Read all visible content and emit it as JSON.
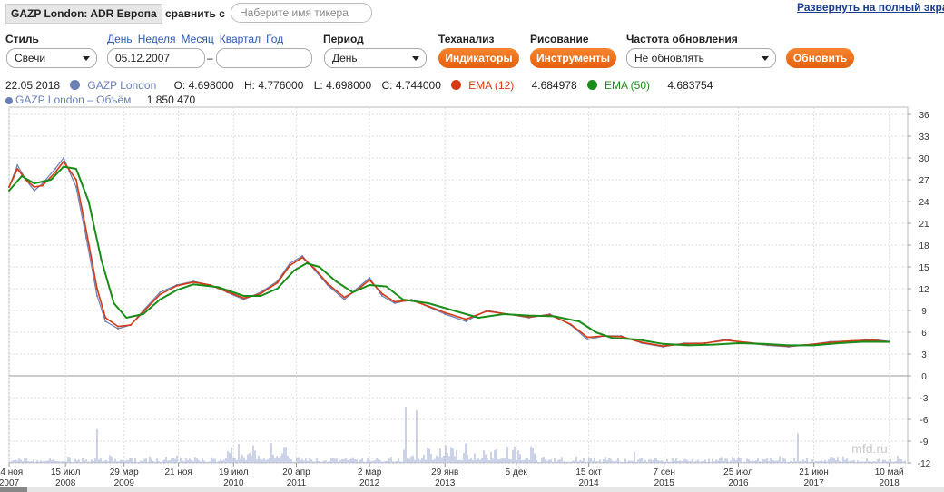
{
  "header": {
    "ticker": "GAZP London: ADR Европа",
    "compare_label": "сравнить с",
    "compare_placeholder": "Наберите имя тикера",
    "fullscreen_link": "Развернуть на полный экра"
  },
  "controls": {
    "style_label": "Стиль",
    "style_value": "Свечи",
    "period_links": [
      "День",
      "Неделя",
      "Месяц",
      "Квартал",
      "Год"
    ],
    "date_from": "05.12.2007",
    "date_dash": "–",
    "date_to": "",
    "period_label": "Период",
    "period_value": "День",
    "ta_label": "Теханализ",
    "ta_button": "Индикаторы",
    "draw_label": "Рисование",
    "draw_button": "Инструменты",
    "refresh_label": "Частота обновления",
    "refresh_value": "Не обновлять",
    "update_button": "Обновить"
  },
  "legend": {
    "date": "22.05.2018",
    "series_name": "GAZP London",
    "open": "O: 4.698000",
    "high": "H: 4.776000",
    "low": "L: 4.698000",
    "close": "C: 4.744000",
    "ema12_name": "EMA (12)",
    "ema12_value": "4.684978",
    "ema50_name": "EMA (50)",
    "ema50_value": "4.683754",
    "volume_name": "GAZP London – Объём",
    "volume_value": "1 850 470"
  },
  "colors": {
    "price": "#6b7fb7",
    "ema12": "#d43a13",
    "ema50": "#1a8c1a",
    "volume": "#9aa6cf",
    "accent": "#e8661a"
  },
  "watermark": "mfd.ru",
  "chart_data": {
    "type": "line",
    "ylim": [
      -12,
      37
    ],
    "yticks": [
      36,
      33,
      30,
      27,
      24,
      21,
      18,
      15,
      12,
      9,
      6,
      3,
      0,
      -3,
      -6,
      -9,
      -12
    ],
    "x_ticks": [
      {
        "t": 0,
        "d": "14 ноя",
        "y": "2007"
      },
      {
        "t": 0.673,
        "d": "15 июл",
        "y": "2008"
      },
      {
        "t": 1.372,
        "d": "29 мар",
        "y": "2009"
      },
      {
        "t": 2.021,
        "d": "21 ноя",
        "y": ""
      },
      {
        "t": 2.678,
        "d": "19 июл",
        "y": "2010"
      },
      {
        "t": 3.427,
        "d": "20 апр",
        "y": "2011"
      },
      {
        "t": 4.3,
        "d": "2 мар",
        "y": "2012"
      },
      {
        "t": 5.2,
        "d": "29 янв",
        "y": "2013"
      },
      {
        "t": 6.05,
        "d": "5 дек",
        "y": ""
      },
      {
        "t": 6.915,
        "d": "15 окт",
        "y": "2014"
      },
      {
        "t": 7.815,
        "d": "7 сен",
        "y": "2015"
      },
      {
        "t": 8.7,
        "d": "25 июл",
        "y": "2016"
      },
      {
        "t": 9.6,
        "d": "21 июн",
        "y": "2017"
      },
      {
        "t": 10.5,
        "d": "10 май",
        "y": "2018"
      }
    ],
    "series": [
      {
        "name": "GAZP London",
        "x": [
          0,
          0.1,
          0.2,
          0.3,
          0.4,
          0.55,
          0.65,
          0.8,
          0.92,
          1.05,
          1.15,
          1.3,
          1.45,
          1.6,
          1.8,
          2.0,
          2.2,
          2.4,
          2.6,
          2.8,
          3.0,
          3.2,
          3.35,
          3.5,
          3.65,
          3.8,
          4.0,
          4.15,
          4.3,
          4.45,
          4.6,
          4.8,
          5.0,
          5.2,
          5.45,
          5.7,
          5.95,
          6.2,
          6.45,
          6.7,
          6.9,
          7.1,
          7.3,
          7.55,
          7.8,
          8.05,
          8.3,
          8.55,
          8.8,
          9.05,
          9.3,
          9.55,
          9.8,
          10.05,
          10.3,
          10.5
        ],
        "values": [
          26,
          29,
          27,
          25.5,
          26.5,
          28.5,
          30,
          26,
          19,
          11,
          7.5,
          6.5,
          7,
          9,
          11.5,
          12.5,
          13,
          12.5,
          11.5,
          10.5,
          11.5,
          13,
          15.5,
          16.5,
          14.5,
          12.5,
          10.5,
          12,
          13.5,
          11,
          10,
          10.5,
          9.5,
          8.5,
          7.5,
          9,
          8.5,
          8,
          8.5,
          7,
          5,
          5.5,
          5.5,
          4.5,
          4,
          4.5,
          4.5,
          5,
          4.5,
          4.2,
          4,
          4.3,
          4.7,
          4.8,
          5,
          4.74
        ]
      },
      {
        "name": "EMA (12)",
        "x": [
          0,
          0.1,
          0.2,
          0.3,
          0.4,
          0.55,
          0.65,
          0.8,
          0.92,
          1.05,
          1.15,
          1.3,
          1.45,
          1.6,
          1.8,
          2.0,
          2.2,
          2.4,
          2.6,
          2.8,
          3.0,
          3.2,
          3.35,
          3.5,
          3.65,
          3.8,
          4.0,
          4.15,
          4.3,
          4.45,
          4.6,
          4.8,
          5.0,
          5.2,
          5.45,
          5.7,
          5.95,
          6.2,
          6.45,
          6.7,
          6.9,
          7.1,
          7.3,
          7.55,
          7.8,
          8.05,
          8.3,
          8.55,
          8.8,
          9.05,
          9.3,
          9.55,
          9.8,
          10.05,
          10.3,
          10.5
        ],
        "values": [
          26,
          28.5,
          27,
          26,
          26.2,
          28,
          29.5,
          27,
          20,
          12,
          8,
          6.8,
          7,
          8.8,
          11.2,
          12.4,
          12.9,
          12.5,
          11.6,
          10.7,
          11.3,
          12.8,
          15.2,
          16.3,
          14.7,
          12.7,
          10.8,
          11.8,
          13.2,
          11.3,
          10.2,
          10.4,
          9.6,
          8.7,
          7.8,
          8.9,
          8.5,
          8.1,
          8.4,
          7.1,
          5.3,
          5.5,
          5.4,
          4.6,
          4.1,
          4.4,
          4.5,
          4.9,
          4.6,
          4.3,
          4.1,
          4.3,
          4.6,
          4.8,
          4.9,
          4.68
        ]
      },
      {
        "name": "EMA (50)",
        "x": [
          0,
          0.15,
          0.3,
          0.5,
          0.65,
          0.8,
          0.95,
          1.1,
          1.25,
          1.4,
          1.6,
          1.8,
          2.0,
          2.2,
          2.5,
          2.8,
          3.0,
          3.2,
          3.4,
          3.55,
          3.7,
          3.9,
          4.1,
          4.3,
          4.5,
          4.7,
          5.0,
          5.3,
          5.6,
          5.9,
          6.2,
          6.5,
          6.8,
          7.0,
          7.2,
          7.5,
          7.8,
          8.1,
          8.4,
          8.7,
          9.0,
          9.3,
          9.6,
          9.9,
          10.2,
          10.5
        ],
        "values": [
          25.5,
          27.5,
          26.5,
          27,
          28.8,
          28.5,
          24,
          16,
          10,
          8,
          8.5,
          10.5,
          11.8,
          12.6,
          12.2,
          11,
          11,
          12,
          14.5,
          15.5,
          15,
          13,
          11.5,
          12.5,
          12.3,
          10.5,
          10,
          9,
          8,
          8.5,
          8.3,
          8.2,
          7.5,
          6,
          5.2,
          5,
          4.4,
          4.2,
          4.3,
          4.5,
          4.4,
          4.2,
          4.2,
          4.5,
          4.7,
          4.68
        ]
      }
    ]
  }
}
